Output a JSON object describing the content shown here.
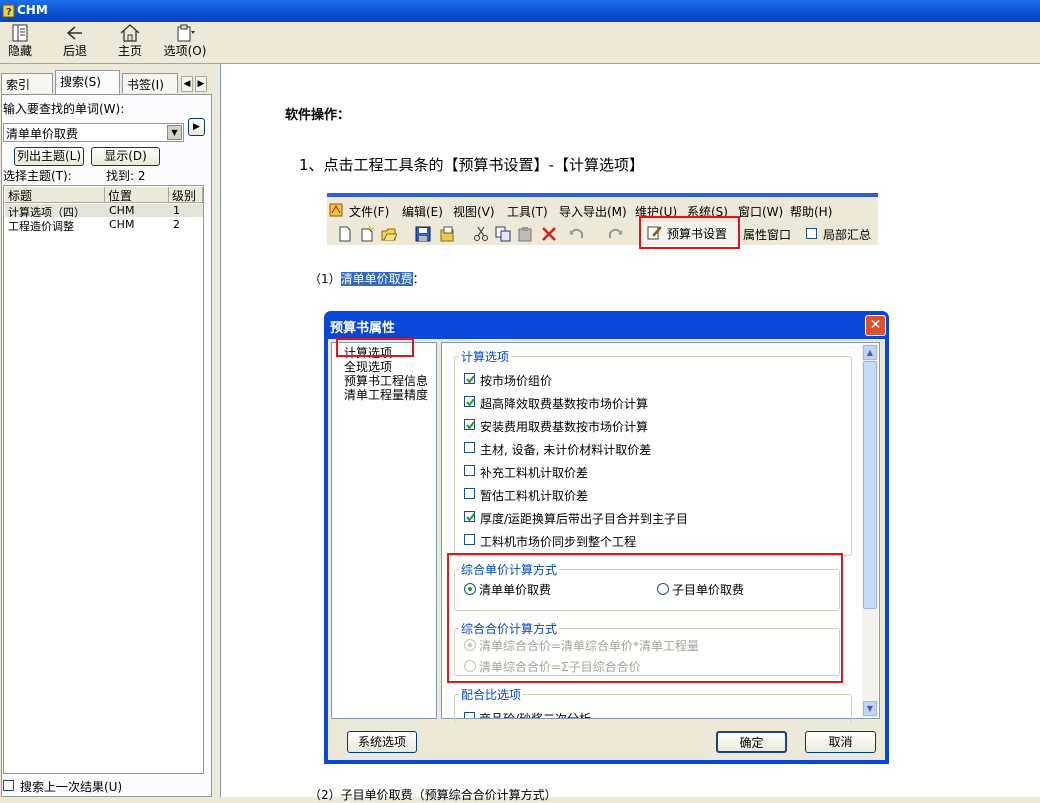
{
  "window": {
    "title": "CHM"
  },
  "toolbar": {
    "hide": "隐藏",
    "back": "后退",
    "home": "主页",
    "options": "选项(O)"
  },
  "left": {
    "tabs": [
      "索引(N)",
      "搜索(S)",
      "书签(I)"
    ],
    "keyword_label": "输入要查找的单词(W):",
    "keyword_value": "清单单价取费",
    "list_topics_button": "列出主题(L)",
    "display_button": "显示(D)",
    "select_topic_label": "选择主题(T):",
    "found_label": "找到: 2",
    "columns": [
      "标题",
      "位置",
      "级别"
    ],
    "rows": [
      {
        "title": "计算选项（四）",
        "location": "CHM",
        "rank": "1"
      },
      {
        "title": "工程造价调整",
        "location": "CHM",
        "rank": "2"
      }
    ],
    "search_previous": "搜索上一次结果(U)"
  },
  "content": {
    "heading": "软件操作：",
    "step1": "1、点击工程工具条的【预算书设置】-【计算选项】",
    "menu": [
      "文件(F)",
      "编辑(E)",
      "视图(V)",
      "工具(T)",
      "导入导出(M)",
      "维护(U)",
      "系统(S)",
      "窗口(W)",
      "帮助(H)"
    ],
    "toolbar_budget": "预算书设置",
    "toolbar_props": "属性窗口",
    "toolbar_local": "局部汇总",
    "sub1_prefix": "（1）",
    "sub1_highlight": "清单单价取费",
    "sub1_suffix": "：",
    "sub2": "（2）子目单价取费（预算综合合价计算方式）"
  },
  "dialog": {
    "title": "预算书属性",
    "tree": [
      "计算选项",
      "全现选项",
      "预算书工程信息",
      "清单工程量精度"
    ],
    "group_calc": "计算选项",
    "options": [
      {
        "label": "按市场价组价",
        "checked": true
      },
      {
        "label": "超高降效取费基数按市场价计算",
        "checked": true
      },
      {
        "label": "安装费用取费基数按市场价计算",
        "checked": true
      },
      {
        "label": "主材, 设备, 未计价材料计取价差",
        "checked": false
      },
      {
        "label": "补充工料机计取价差",
        "checked": false
      },
      {
        "label": "暂估工料机计取价差",
        "checked": false
      },
      {
        "label": "厚度/运距换算后带出子目合并到主子目",
        "checked": true
      },
      {
        "label": "工料机市场价同步到整个工程",
        "checked": false
      }
    ],
    "group_unit": "综合单价计算方式",
    "unit_opt1": "清单单价取费",
    "unit_opt2": "子目单价取费",
    "group_total": "综合合价计算方式",
    "total_opt1": "清单综合合价=清单综合单价*清单工程量",
    "total_opt2": "清单综合合价=Σ子目综合合价",
    "group_mix": "配合比选项",
    "mix_opt1": "商品砼/砂浆二次分析",
    "system_button": "系统选项",
    "ok_button": "确定",
    "cancel_button": "取消"
  }
}
